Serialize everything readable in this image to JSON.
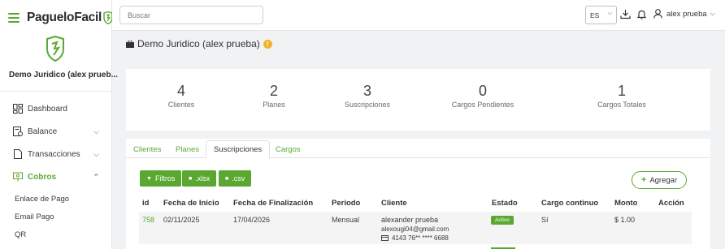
{
  "brand": {
    "name": "PagueloFacil"
  },
  "sidebar": {
    "company": "Demo Juridico (alex prueb...",
    "items": [
      {
        "label": "Dashboard"
      },
      {
        "label": "Balance"
      },
      {
        "label": "Transacciones"
      },
      {
        "label": "Cobros"
      }
    ],
    "sub_items": [
      {
        "label": "Enlace de Pago"
      },
      {
        "label": "Email Pago"
      },
      {
        "label": "QR"
      }
    ]
  },
  "topbar": {
    "search_placeholder": "Buscar",
    "language": "ES",
    "user": "alex prueba"
  },
  "page": {
    "title": "Demo Juridico (alex prueba)",
    "info": "!"
  },
  "stats": [
    {
      "value": "4",
      "label": "Clientes"
    },
    {
      "value": "2",
      "label": "Planes"
    },
    {
      "value": "3",
      "label": "Suscripciones"
    },
    {
      "value": "0",
      "label": "Cargos Pendientes"
    },
    {
      "value": "1",
      "label": "Cargos Totales"
    }
  ],
  "tabs": [
    {
      "label": "Clientes"
    },
    {
      "label": "Planes"
    },
    {
      "label": "Suscripciones"
    },
    {
      "label": "Cargos"
    }
  ],
  "actions": {
    "filters": "Filtros",
    "xlsx": ".xlsx",
    "csv": ".csv",
    "add": "Agregar"
  },
  "table": {
    "columns": [
      "id",
      "Fecha de Inicio",
      "Fecha de Finalización",
      "Periodo",
      "Cliente",
      "Estado",
      "Cargo continuo",
      "Monto",
      "Acción"
    ],
    "rows": [
      {
        "id": "758",
        "start": "02/11/2025",
        "end": "17/04/2026",
        "period": "Mensual",
        "client_name": "alexander prueba",
        "client_email": "alexougi04@gmail.com",
        "client_card": "4143 76** **** 6688",
        "status": "Activo",
        "continuous": "Sí",
        "amount": "$ 1.00"
      }
    ]
  },
  "colors": {
    "accent": "#5aa831",
    "warning": "#f0b429"
  }
}
